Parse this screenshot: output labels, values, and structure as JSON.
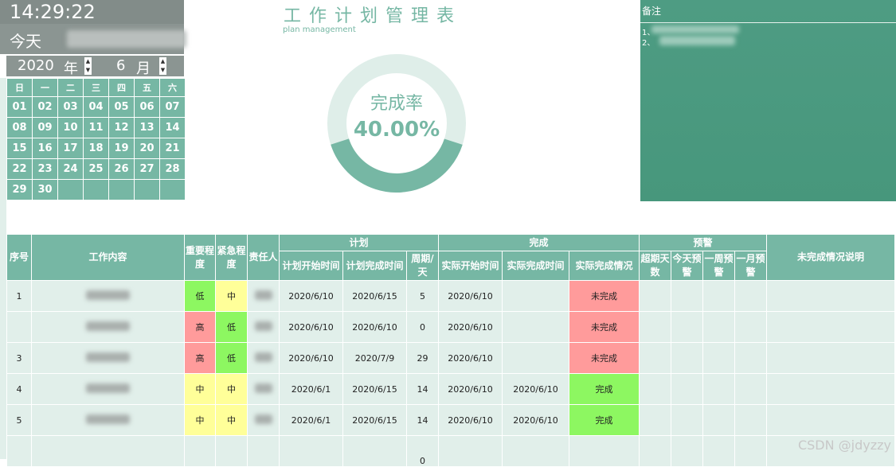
{
  "clock": "14:29:22",
  "today_label": "今天",
  "year": "2020",
  "year_unit": "年",
  "month": "6",
  "month_unit": "月",
  "spin_up": "▲",
  "spin_down": "▼",
  "weekdays": [
    "日",
    "一",
    "二",
    "三",
    "四",
    "五",
    "六"
  ],
  "calendar_rows": [
    [
      "01",
      "02",
      "03",
      "04",
      "05",
      "06",
      "07"
    ],
    [
      "08",
      "09",
      "10",
      "11",
      "12",
      "13",
      "14"
    ],
    [
      "15",
      "16",
      "17",
      "18",
      "19",
      "20",
      "21"
    ],
    [
      "22",
      "23",
      "24",
      "25",
      "26",
      "27",
      "28"
    ],
    [
      "29",
      "30",
      "",
      "",
      "",
      "",
      ""
    ]
  ],
  "title": "工作计划管理表",
  "subtitle": "plan management",
  "completion": {
    "label": "完成率",
    "value_text": "40.00%",
    "fraction": 0.4,
    "track_color": "#dfeee9",
    "fill_color": "#76b7a4"
  },
  "remark": {
    "header": "备注",
    "line1": "1、",
    "line2": "2、"
  },
  "table": {
    "headers": {
      "index": "序号",
      "content": "工作内容",
      "importance": "重要程度",
      "urgency": "紧急程度",
      "owner": "责任人",
      "plan": "计划",
      "done": "完成",
      "warning": "预警",
      "note": "未完成情况说明",
      "plan_start": "计划开始时间",
      "plan_end": "计划完成时间",
      "period": "周期/天",
      "actual_start": "实际开始时间",
      "actual_end": "实际完成时间",
      "actual_status": "实际完成情况",
      "overdue": "超期天数",
      "today_warn": "今天预警",
      "week_warn": "一周预警",
      "month_warn": "一月预警"
    },
    "rows": [
      {
        "index": "1",
        "importance": "低",
        "urgency": "中",
        "plan_start": "2020/6/10",
        "plan_end": "2020/6/15",
        "period": "5",
        "actual_start": "2020/6/10",
        "actual_end": "",
        "status": "未完成"
      },
      {
        "index": "",
        "importance": "高",
        "urgency": "低",
        "plan_start": "2020/6/10",
        "plan_end": "2020/6/10",
        "period": "0",
        "actual_start": "2020/6/10",
        "actual_end": "",
        "status": "未完成"
      },
      {
        "index": "3",
        "importance": "高",
        "urgency": "低",
        "plan_start": "2020/6/10",
        "plan_end": "2020/7/9",
        "period": "29",
        "actual_start": "2020/6/10",
        "actual_end": "",
        "status": "未完成"
      },
      {
        "index": "4",
        "importance": "中",
        "urgency": "中",
        "plan_start": "2020/6/1",
        "plan_end": "2020/6/15",
        "period": "14",
        "actual_start": "2020/6/10",
        "actual_end": "2020/6/10",
        "status": "完成"
      },
      {
        "index": "5",
        "importance": "中",
        "urgency": "中",
        "plan_start": "2020/6/1",
        "plan_end": "2020/6/15",
        "period": "14",
        "actual_start": "2020/6/10",
        "actual_end": "2020/6/10",
        "status": "完成"
      },
      {
        "index": "",
        "importance": "",
        "urgency": "",
        "plan_start": "",
        "plan_end": "",
        "period": "0",
        "actual_start": "",
        "actual_end": "",
        "status": ""
      }
    ]
  },
  "watermark": "CSDN @jdyzzy"
}
